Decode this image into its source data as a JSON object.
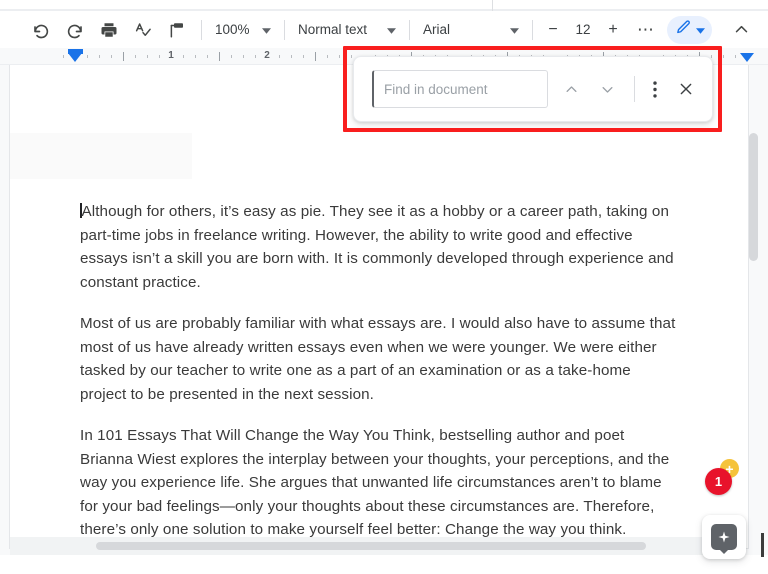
{
  "toolbar": {
    "icons": [
      {
        "name": "undo-icon",
        "label": "Undo"
      },
      {
        "name": "redo-icon",
        "label": "Redo"
      },
      {
        "name": "print-icon",
        "label": "Print"
      },
      {
        "name": "spelling-check-icon",
        "label": "Spelling and grammar check"
      },
      {
        "name": "paint-format-icon",
        "label": "Paint format"
      }
    ],
    "zoom_value": "100%",
    "paragraph_style": "Normal text",
    "font_family": "Arial",
    "font_size": "12",
    "decrease_font_label": "−",
    "increase_font_label": "+",
    "more_label": "⋯",
    "editing_mode_label": "Editing",
    "collapse_label": "Hide the menus"
  },
  "ruler": {
    "numbers": [
      "1",
      "2"
    ],
    "left_indent_name": "left-indent-marker",
    "right_indent_name": "right-indent-marker"
  },
  "find_bar": {
    "placeholder": "Find in document",
    "value": "",
    "previous_label": "Previous",
    "next_label": "Next",
    "options_label": "⋮",
    "close_label": "✕"
  },
  "document": {
    "paragraphs": [
      "Although for others, it’s easy as pie. They see it as a hobby or a career path, taking on part-time jobs in freelance writing. However, the ability to write good and effective essays isn’t a skill you are born with. It is commonly developed through experience and constant practice.",
      "Most of us are probably familiar with what essays are. I would also have to assume that most of us have already written essays even when we were younger. We were either tasked by our teacher to write one as a part of an examination or as a take-home project to be presented in the next session.",
      "In 101 Essays That Will Change the Way You Think, bestselling author and poet Brianna Wiest explores the interplay between your thoughts, your perceptions, and the way you experience life. She argues that unwanted life circumstances aren’t to blame for your bad feelings—only your thoughts about these circumstances are. Therefore, there’s only one solution to make yourself feel better: Change the way you think."
    ]
  },
  "overlays": {
    "plus_badge": "+",
    "count_badge": "1",
    "assistant_icon_name": "sparkle-pin-icon"
  },
  "colors": {
    "highlight_red": "#f91e1e",
    "badge_red": "#e8132b",
    "badge_yellow": "#f5c33b",
    "accent_blue": "#1a73e8",
    "chip_blue_bg": "#e8f0fe"
  }
}
